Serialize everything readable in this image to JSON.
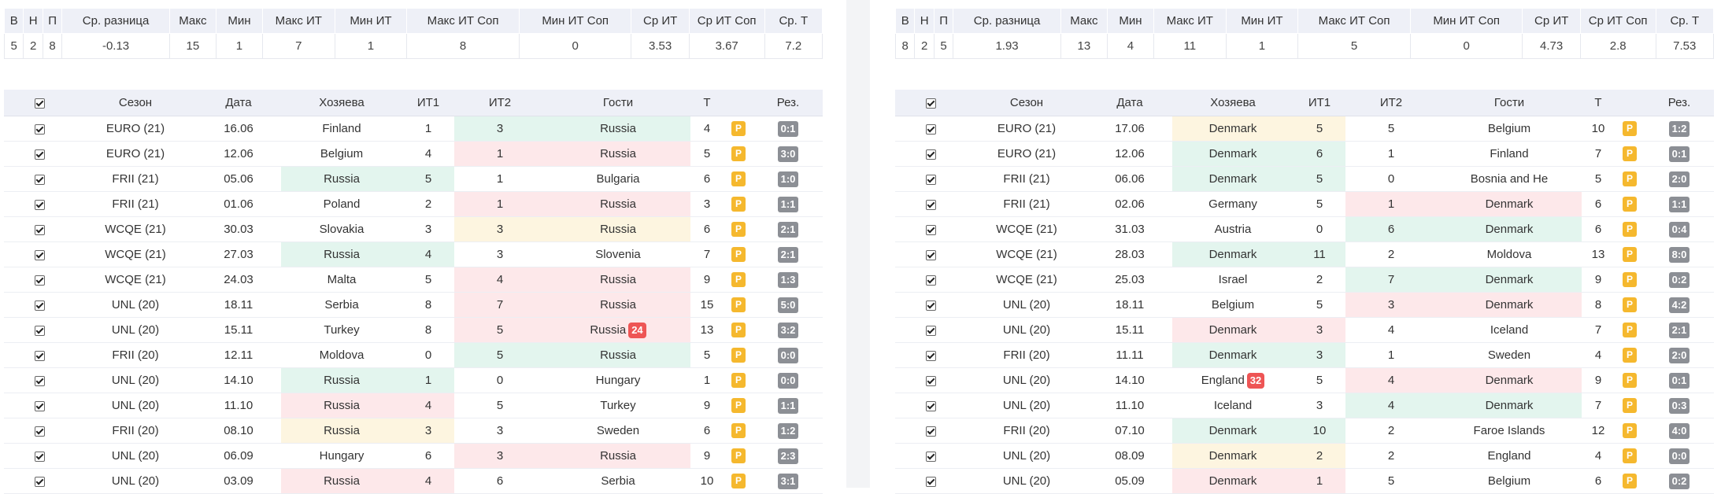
{
  "summary_headers": [
    "В",
    "Н",
    "П",
    "Ср. разница",
    "Макс",
    "Мин",
    "Макс ИТ",
    "Мин ИТ",
    "Макс ИТ Соп",
    "Мин ИТ Соп",
    "Ср ИТ",
    "Ср ИТ Соп",
    "Ср. Т"
  ],
  "match_headers": {
    "season": "Сезон",
    "date": "Дата",
    "home": "Хозяева",
    "it1": "ИТ1",
    "it2": "ИТ2",
    "away": "Гости",
    "t": "Т",
    "p": "",
    "res": "Рез."
  },
  "panels": [
    {
      "summary": [
        "5",
        "2",
        "8",
        "-0.13",
        "15",
        "1",
        "7",
        "1",
        "8",
        "0",
        "3.53",
        "3.67",
        "7.2"
      ],
      "rows": [
        {
          "season": "EURO (21)",
          "date": "16.06",
          "home": "Finland",
          "home_hl": "",
          "it1": "1",
          "it2": "3",
          "it2_hl": "green",
          "away": "Russia",
          "away_hl": "green",
          "away_badge": "",
          "home_badge": "",
          "t": "4",
          "p": "P",
          "res": "0:1"
        },
        {
          "season": "EURO (21)",
          "date": "12.06",
          "home": "Belgium",
          "home_hl": "",
          "it1": "4",
          "it2": "1",
          "it2_hl": "red",
          "away": "Russia",
          "away_hl": "red",
          "away_badge": "",
          "home_badge": "",
          "t": "5",
          "p": "P",
          "res": "3:0"
        },
        {
          "season": "FRII (21)",
          "date": "05.06",
          "home": "Russia",
          "home_hl": "green",
          "it1": "5",
          "it2": "1",
          "it2_hl": "",
          "away": "Bulgaria",
          "away_hl": "",
          "away_badge": "",
          "home_badge": "",
          "t": "6",
          "p": "P",
          "res": "1:0"
        },
        {
          "season": "FRII (21)",
          "date": "01.06",
          "home": "Poland",
          "home_hl": "",
          "it1": "2",
          "it2": "1",
          "it2_hl": "red",
          "away": "Russia",
          "away_hl": "red",
          "away_badge": "",
          "home_badge": "",
          "t": "3",
          "p": "P",
          "res": "1:1"
        },
        {
          "season": "WCQE (21)",
          "date": "30.03",
          "home": "Slovakia",
          "home_hl": "",
          "it1": "3",
          "it2": "3",
          "it2_hl": "yellow",
          "away": "Russia",
          "away_hl": "yellow",
          "away_badge": "",
          "home_badge": "",
          "t": "6",
          "p": "P",
          "res": "2:1"
        },
        {
          "season": "WCQE (21)",
          "date": "27.03",
          "home": "Russia",
          "home_hl": "green",
          "it1": "4",
          "it2": "3",
          "it2_hl": "",
          "away": "Slovenia",
          "away_hl": "",
          "away_badge": "",
          "home_badge": "",
          "t": "7",
          "p": "P",
          "res": "2:1"
        },
        {
          "season": "WCQE (21)",
          "date": "24.03",
          "home": "Malta",
          "home_hl": "",
          "it1": "5",
          "it2": "4",
          "it2_hl": "red",
          "away": "Russia",
          "away_hl": "red",
          "away_badge": "",
          "home_badge": "",
          "t": "9",
          "p": "P",
          "res": "1:3"
        },
        {
          "season": "UNL (20)",
          "date": "18.11",
          "home": "Serbia",
          "home_hl": "",
          "it1": "8",
          "it2": "7",
          "it2_hl": "red",
          "away": "Russia",
          "away_hl": "red",
          "away_badge": "",
          "home_badge": "",
          "t": "15",
          "p": "P",
          "res": "5:0"
        },
        {
          "season": "UNL (20)",
          "date": "15.11",
          "home": "Turkey",
          "home_hl": "",
          "it1": "8",
          "it2": "5",
          "it2_hl": "red",
          "away": "Russia",
          "away_hl": "red",
          "away_badge": "24",
          "home_badge": "",
          "t": "13",
          "p": "P",
          "res": "3:2"
        },
        {
          "season": "FRII (20)",
          "date": "12.11",
          "home": "Moldova",
          "home_hl": "",
          "it1": "0",
          "it2": "5",
          "it2_hl": "green",
          "away": "Russia",
          "away_hl": "green",
          "away_badge": "",
          "home_badge": "",
          "t": "5",
          "p": "P",
          "res": "0:0"
        },
        {
          "season": "UNL (20)",
          "date": "14.10",
          "home": "Russia",
          "home_hl": "green",
          "it1": "1",
          "it2": "0",
          "it2_hl": "",
          "away": "Hungary",
          "away_hl": "",
          "away_badge": "",
          "home_badge": "",
          "t": "1",
          "p": "P",
          "res": "0:0"
        },
        {
          "season": "UNL (20)",
          "date": "11.10",
          "home": "Russia",
          "home_hl": "red",
          "it1": "4",
          "it2": "5",
          "it2_hl": "",
          "away": "Turkey",
          "away_hl": "",
          "away_badge": "",
          "home_badge": "",
          "t": "9",
          "p": "P",
          "res": "1:1"
        },
        {
          "season": "FRII (20)",
          "date": "08.10",
          "home": "Russia",
          "home_hl": "yellow",
          "it1": "3",
          "it2": "3",
          "it2_hl": "",
          "away": "Sweden",
          "away_hl": "",
          "away_badge": "",
          "home_badge": "",
          "t": "6",
          "p": "P",
          "res": "1:2"
        },
        {
          "season": "UNL (20)",
          "date": "06.09",
          "home": "Hungary",
          "home_hl": "",
          "it1": "6",
          "it2": "3",
          "it2_hl": "red",
          "away": "Russia",
          "away_hl": "red",
          "away_badge": "",
          "home_badge": "",
          "t": "9",
          "p": "P",
          "res": "2:3"
        },
        {
          "season": "UNL (20)",
          "date": "03.09",
          "home": "Russia",
          "home_hl": "red",
          "it1": "4",
          "it2": "6",
          "it2_hl": "",
          "away": "Serbia",
          "away_hl": "",
          "away_badge": "",
          "home_badge": "",
          "t": "10",
          "p": "P",
          "res": "3:1"
        }
      ]
    },
    {
      "summary": [
        "8",
        "2",
        "5",
        "1.93",
        "13",
        "4",
        "11",
        "1",
        "5",
        "0",
        "4.73",
        "2.8",
        "7.53"
      ],
      "rows": [
        {
          "season": "EURO (21)",
          "date": "17.06",
          "home": "Denmark",
          "home_hl": "yellow",
          "it1": "5",
          "it2": "5",
          "it2_hl": "",
          "away": "Belgium",
          "away_hl": "",
          "away_badge": "",
          "home_badge": "",
          "t": "10",
          "p": "P",
          "res": "1:2"
        },
        {
          "season": "EURO (21)",
          "date": "12.06",
          "home": "Denmark",
          "home_hl": "green",
          "it1": "6",
          "it2": "1",
          "it2_hl": "",
          "away": "Finland",
          "away_hl": "",
          "away_badge": "",
          "home_badge": "",
          "t": "7",
          "p": "P",
          "res": "0:1"
        },
        {
          "season": "FRII (21)",
          "date": "06.06",
          "home": "Denmark",
          "home_hl": "green",
          "it1": "5",
          "it2": "0",
          "it2_hl": "",
          "away": "Bosnia and He",
          "away_hl": "",
          "away_badge": "",
          "home_badge": "",
          "t": "5",
          "p": "P",
          "res": "2:0"
        },
        {
          "season": "FRII (21)",
          "date": "02.06",
          "home": "Germany",
          "home_hl": "",
          "it1": "5",
          "it2": "1",
          "it2_hl": "red",
          "away": "Denmark",
          "away_hl": "red",
          "away_badge": "",
          "home_badge": "",
          "t": "6",
          "p": "P",
          "res": "1:1"
        },
        {
          "season": "WCQE (21)",
          "date": "31.03",
          "home": "Austria",
          "home_hl": "",
          "it1": "0",
          "it2": "6",
          "it2_hl": "green",
          "away": "Denmark",
          "away_hl": "green",
          "away_badge": "",
          "home_badge": "",
          "t": "6",
          "p": "P",
          "res": "0:4"
        },
        {
          "season": "WCQE (21)",
          "date": "28.03",
          "home": "Denmark",
          "home_hl": "green",
          "it1": "11",
          "it2": "2",
          "it2_hl": "",
          "away": "Moldova",
          "away_hl": "",
          "away_badge": "",
          "home_badge": "",
          "t": "13",
          "p": "P",
          "res": "8:0"
        },
        {
          "season": "WCQE (21)",
          "date": "25.03",
          "home": "Israel",
          "home_hl": "",
          "it1": "2",
          "it2": "7",
          "it2_hl": "green",
          "away": "Denmark",
          "away_hl": "green",
          "away_badge": "",
          "home_badge": "",
          "t": "9",
          "p": "P",
          "res": "0:2"
        },
        {
          "season": "UNL (20)",
          "date": "18.11",
          "home": "Belgium",
          "home_hl": "",
          "it1": "5",
          "it2": "3",
          "it2_hl": "red",
          "away": "Denmark",
          "away_hl": "red",
          "away_badge": "",
          "home_badge": "",
          "t": "8",
          "p": "P",
          "res": "4:2"
        },
        {
          "season": "UNL (20)",
          "date": "15.11",
          "home": "Denmark",
          "home_hl": "red",
          "it1": "3",
          "it2": "4",
          "it2_hl": "",
          "away": "Iceland",
          "away_hl": "",
          "away_badge": "",
          "home_badge": "",
          "t": "7",
          "p": "P",
          "res": "2:1"
        },
        {
          "season": "FRII (20)",
          "date": "11.11",
          "home": "Denmark",
          "home_hl": "green",
          "it1": "3",
          "it2": "1",
          "it2_hl": "",
          "away": "Sweden",
          "away_hl": "",
          "away_badge": "",
          "home_badge": "",
          "t": "4",
          "p": "P",
          "res": "2:0"
        },
        {
          "season": "UNL (20)",
          "date": "14.10",
          "home": "England",
          "home_hl": "",
          "it1": "5",
          "it2": "4",
          "it2_hl": "red",
          "away": "Denmark",
          "away_hl": "red",
          "away_badge": "",
          "home_badge": "32",
          "t": "9",
          "p": "P",
          "res": "0:1"
        },
        {
          "season": "UNL (20)",
          "date": "11.10",
          "home": "Iceland",
          "home_hl": "",
          "it1": "3",
          "it2": "4",
          "it2_hl": "green",
          "away": "Denmark",
          "away_hl": "green",
          "away_badge": "",
          "home_badge": "",
          "t": "7",
          "p": "P",
          "res": "0:3"
        },
        {
          "season": "FRII (20)",
          "date": "07.10",
          "home": "Denmark",
          "home_hl": "green",
          "it1": "10",
          "it2": "2",
          "it2_hl": "",
          "away": "Faroe Islands",
          "away_hl": "",
          "away_badge": "",
          "home_badge": "",
          "t": "12",
          "p": "P",
          "res": "4:0"
        },
        {
          "season": "UNL (20)",
          "date": "08.09",
          "home": "Denmark",
          "home_hl": "yellow",
          "it1": "2",
          "it2": "2",
          "it2_hl": "",
          "away": "England",
          "away_hl": "",
          "away_badge": "",
          "home_badge": "",
          "t": "4",
          "p": "P",
          "res": "0:0"
        },
        {
          "season": "UNL (20)",
          "date": "05.09",
          "home": "Denmark",
          "home_hl": "red",
          "it1": "1",
          "it2": "5",
          "it2_hl": "",
          "away": "Belgium",
          "away_hl": "",
          "away_badge": "",
          "home_badge": "",
          "t": "6",
          "p": "P",
          "res": "0:2"
        }
      ]
    }
  ]
}
